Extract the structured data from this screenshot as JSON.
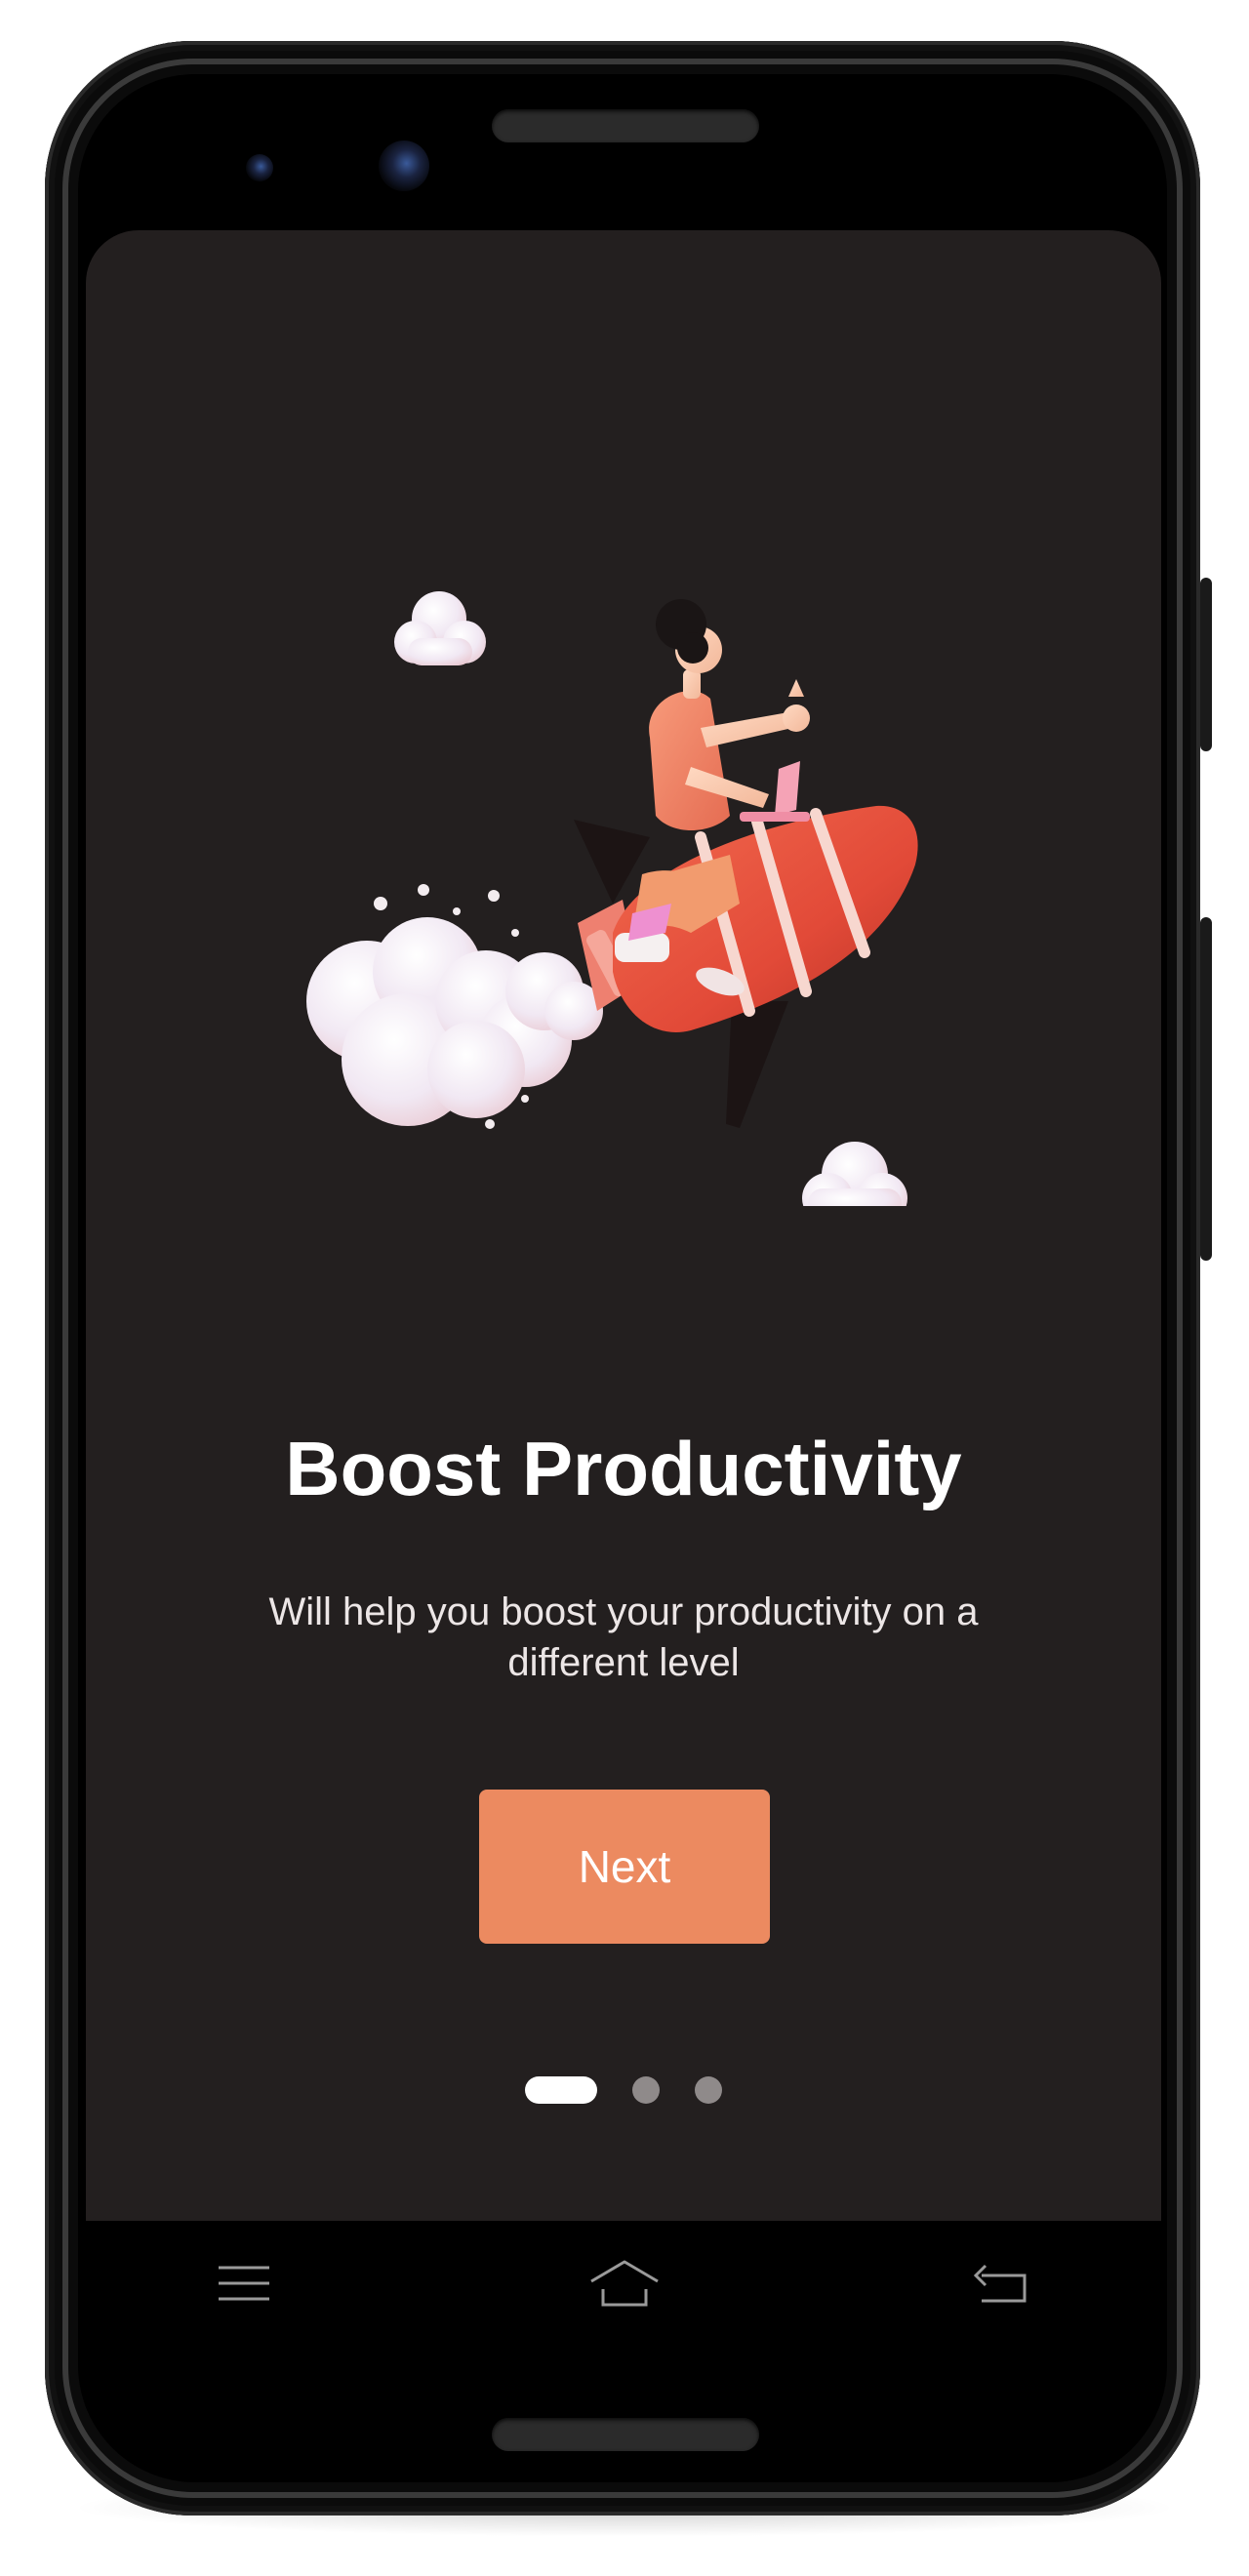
{
  "onboarding": {
    "title": "Boost Productivity",
    "description": "Will help you boost your productivity on a different level",
    "next_label": "Next",
    "illustration_icon": "rocket-person-illustration",
    "pagination": {
      "total": 3,
      "active_index": 0
    }
  },
  "navigation_bar": {
    "buttons": [
      {
        "icon": "menu-icon"
      },
      {
        "icon": "home-icon"
      },
      {
        "icon": "back-icon"
      }
    ]
  },
  "colors": {
    "background": "#231f1f",
    "accent": "#ec8a60",
    "text": "#ffffff",
    "dot_active": "#ffffff",
    "dot_inactive": "#8f8a8a",
    "device_frame": "#0b0b0b"
  }
}
